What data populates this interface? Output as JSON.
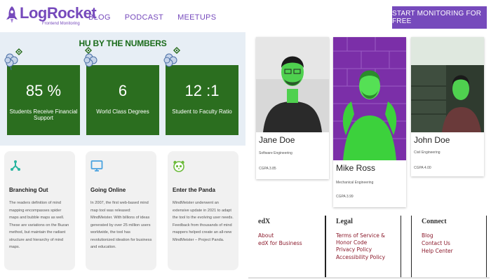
{
  "header": {
    "logo_name": "LogRocket",
    "logo_sub": "Frontend Monitoring",
    "nav": [
      "BLOG",
      "PODCAST",
      "MEETUPS"
    ],
    "cta": "START MONITORING FOR FREE"
  },
  "stats": {
    "title": "HU BY THE NUMBERS",
    "cards": [
      {
        "number": "85 %",
        "label": "Students Receive Financial Support"
      },
      {
        "number": "6",
        "label": "World Class Degrees"
      },
      {
        "number": "12 :1",
        "label": "Student to Faculty Ratio"
      }
    ]
  },
  "info_cards": [
    {
      "icon": "branch-icon",
      "title": "Branching Out",
      "text": "The readers definition of mind mapping encompasses spider maps and bubble maps as well. These are variations on the Buzan method, but maintain the radiant structure and hierarchy of mind maps."
    },
    {
      "icon": "monitor-icon",
      "title": "Going Online",
      "text": "In 2007, the first web-based mind map tool was released: MindMeister. With billions of ideas generated by over 25 million users worldwide, the tool has revolutionized ideation for business and education."
    },
    {
      "icon": "panda-icon",
      "title": "Enter the Panda",
      "text": "MindMeister underwent an extensive update in 2021 to adapt the tool to the evolving user needs. Feedback from thousands of mind mappers helped create an all-new MindMeister – Project Panda."
    }
  ],
  "profiles": [
    {
      "name": "Jane Doe",
      "dept": "Software Engineering",
      "gpa": "CGPA 3.85"
    },
    {
      "name": "Mike Ross",
      "dept": "Mechanical Engineering",
      "gpa": "CGPA 3.99"
    },
    {
      "name": "John Doe",
      "dept": "Civil Engineering",
      "gpa": "CGPA 4.00"
    }
  ],
  "footer": {
    "cols": [
      {
        "heading": "edX",
        "links": [
          "About",
          "edX for Business"
        ]
      },
      {
        "heading": "Legal",
        "links": [
          "Terms of Service &",
          "Honor Code",
          "Privacy Policy",
          "Accessibility Policy"
        ]
      },
      {
        "heading": "Connect",
        "links": [
          "Blog",
          "Contact Us",
          "Help Center"
        ]
      }
    ]
  },
  "colors": {
    "brand": "#764abc",
    "stat_green": "#2b6e1f",
    "link_maroon": "#8b1a2b"
  }
}
